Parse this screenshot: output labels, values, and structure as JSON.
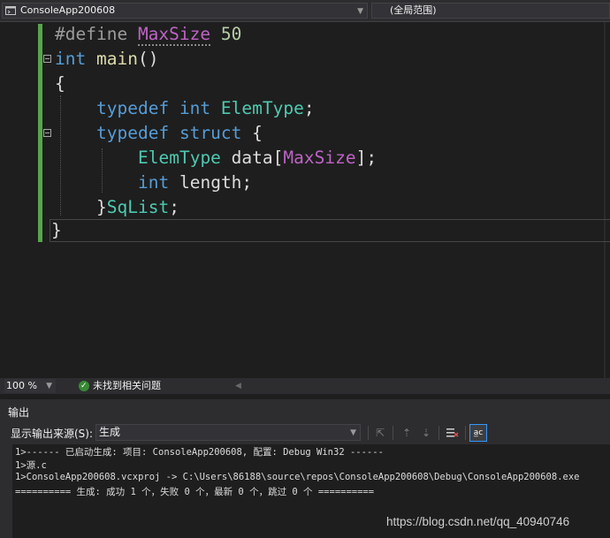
{
  "navbar": {
    "project": "ConsoleApp200608",
    "scope": "(全局范围)"
  },
  "code": {
    "line1_directive": "#define",
    "line1_macro": "MaxSize",
    "line1_value": "50",
    "line2_type": "int",
    "line2_func": "main",
    "line2_parens": "()",
    "line3": "{",
    "line4_kw": "typedef",
    "line4_type": "int",
    "line4_name": "ElemType",
    "line4_semi": ";",
    "line5_kw1": "typedef",
    "line5_kw2": "struct",
    "line5_brace": "{",
    "line6_type": "ElemType",
    "line6_field": "data",
    "line6_open": "[",
    "line6_macro": "MaxSize",
    "line6_close": "];",
    "line7_type": "int",
    "line7_field": "length;",
    "line8_brace": "}",
    "line8_name": "SqList",
    "line8_semi": ";",
    "line9": "}"
  },
  "status": {
    "zoom": "100 %",
    "issues": "未找到相关问题"
  },
  "output": {
    "title": "输出",
    "source_label": "显示输出来源(S):",
    "source_value": "生成",
    "lines": [
      "1>------ 已启动生成: 项目: ConsoleApp200608, 配置: Debug Win32 ------",
      "1>源.c",
      "1>ConsoleApp200608.vcxproj -> C:\\Users\\86188\\source\\repos\\ConsoleApp200608\\Debug\\ConsoleApp200608.exe",
      "========== 生成: 成功 1 个，失败 0 个，最新 0 个，跳过 0 个 =========="
    ]
  },
  "watermark": "https://blog.csdn.net/qq_40940746",
  "icons": {
    "project": "console-app-icon",
    "check": "check-circle-icon",
    "wrap": "word-wrap-icon"
  }
}
